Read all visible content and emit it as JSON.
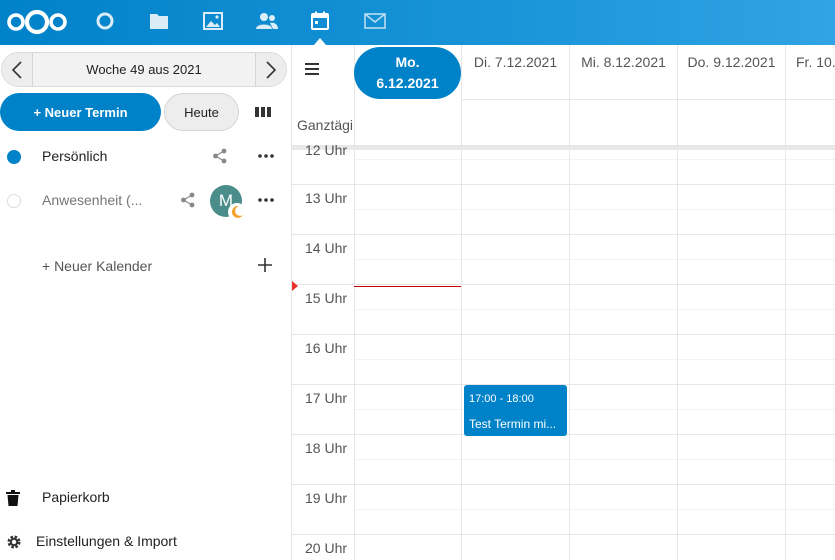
{
  "header": {
    "apps": [
      {
        "name": "dashboard-icon"
      },
      {
        "name": "files-icon"
      },
      {
        "name": "photos-icon"
      },
      {
        "name": "contacts-icon"
      },
      {
        "name": "calendar-icon",
        "active": true
      },
      {
        "name": "mail-icon"
      }
    ],
    "accent": "#0082c9"
  },
  "sidebar": {
    "week_label": "Woche 49 aus 2021",
    "new_event_label": "+ Neuer Termin",
    "today_label": "Heute",
    "calendars": [
      {
        "label": "Persönlich",
        "color": "#0082c9"
      },
      {
        "label": "Anwesenheit (...",
        "avatar_letter": "M"
      }
    ],
    "new_calendar_label": "+ Neuer Kalender",
    "trash_label": "Papierkorb",
    "settings_label": "Einstellungen & Import"
  },
  "calendar": {
    "days": [
      {
        "line1": "Mo.",
        "line2": "6.12.2021",
        "today": true
      },
      {
        "label": "Di. 7.12.2021"
      },
      {
        "label": "Mi. 8.12.2021"
      },
      {
        "label": "Do. 9.12.2021"
      },
      {
        "label": "Fr. 10."
      }
    ],
    "allday_label": "Ganztägig",
    "partial_hour_label": "12 Uhr",
    "hours": [
      "13 Uhr",
      "14 Uhr",
      "15 Uhr",
      "16 Uhr",
      "17 Uhr",
      "18 Uhr",
      "19 Uhr",
      "20 Uhr"
    ],
    "event": {
      "time": "17:00 - 18:00",
      "title": "Test Termin mi...",
      "day": "Di. 7.12.2021",
      "color": "#0082c9"
    }
  }
}
